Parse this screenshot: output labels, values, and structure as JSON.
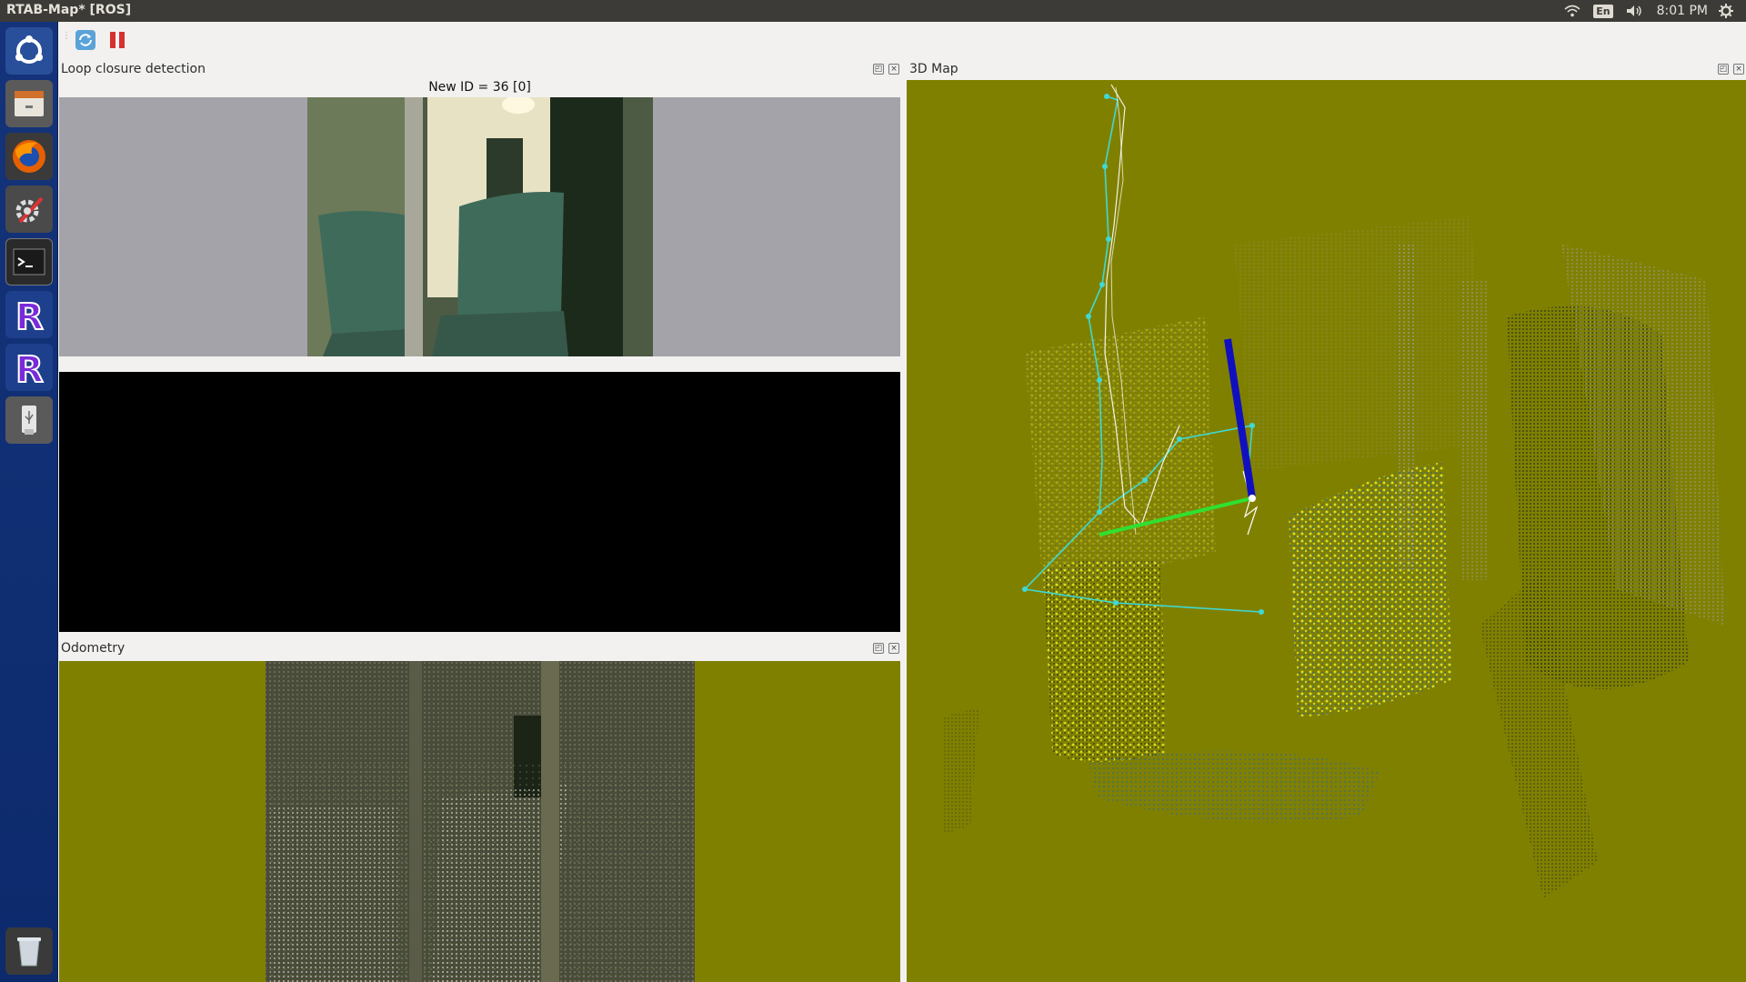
{
  "window": {
    "title": "RTAB-Map* [ROS]"
  },
  "top_panel": {
    "keyboard_layout": "En",
    "clock": "8:01 PM"
  },
  "launcher": {
    "items": [
      {
        "name": "dash-icon"
      },
      {
        "name": "files-icon"
      },
      {
        "name": "firefox-icon"
      },
      {
        "name": "system-settings-icon"
      },
      {
        "name": "terminal-icon"
      },
      {
        "name": "rtabmap-icon"
      },
      {
        "name": "rtabmap-icon"
      },
      {
        "name": "usb-drive-icon"
      },
      {
        "name": "trash-icon"
      }
    ]
  },
  "toolbar": {
    "refresh_icon": "refresh-icon",
    "pause_icon": "pause-icon"
  },
  "docks": {
    "loop_closure": {
      "title": "Loop closure detection",
      "new_id_text": "New ID = 36 [0]"
    },
    "odometry": {
      "title": "Odometry"
    },
    "map3d": {
      "title": "3D Map"
    }
  },
  "colors": {
    "launcher_bg": "#0c2a6c",
    "top_panel_bg": "#3c3b37",
    "olive_bg": "#808000",
    "gray_bg": "#a4a3a9",
    "trajectory": "#3fd9d4",
    "features": "#f0f020"
  }
}
